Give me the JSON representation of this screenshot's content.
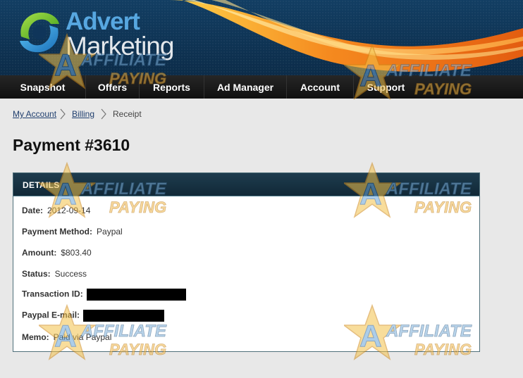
{
  "logo": {
    "word1": "Advert",
    "word2": "Marketing"
  },
  "nav": {
    "items": [
      {
        "label": "Snapshot",
        "name": "nav-snapshot"
      },
      {
        "label": "Offers",
        "name": "nav-offers"
      },
      {
        "label": "Reports",
        "name": "nav-reports"
      },
      {
        "label": "Ad Manager",
        "name": "nav-ad-manager"
      },
      {
        "label": "Account",
        "name": "nav-account"
      },
      {
        "label": "Support",
        "name": "nav-support"
      }
    ]
  },
  "breadcrumb": {
    "items": [
      {
        "label": "My Account",
        "link": true
      },
      {
        "label": "Billing",
        "link": true
      },
      {
        "label": "Receipt",
        "link": false
      }
    ]
  },
  "page": {
    "title": "Payment #3610"
  },
  "details": {
    "header": "DETAILS",
    "rows": [
      {
        "label": "Date:",
        "value": "2012-09-14"
      },
      {
        "label": "Payment Method:",
        "value": "Paypal"
      },
      {
        "label": "Amount:",
        "value": "$803.40"
      },
      {
        "label": "Status:",
        "value": "Success"
      },
      {
        "label": "Transaction ID:",
        "value": "",
        "redacted": true
      },
      {
        "label": "Paypal E-mail:",
        "value": "",
        "redacted": true
      },
      {
        "label": "Memo:",
        "value": "Paid via Paypal"
      }
    ]
  },
  "watermark": {
    "line1": "AFFILIATE",
    "line2": "PAYING",
    "letter": "A"
  },
  "colors": {
    "header_bg": "#123e63",
    "swoosh": "#f07a1a",
    "logo_blue": "#57a7e0",
    "link": "#1f3e6e",
    "panel_header": "#1e3c4e"
  }
}
